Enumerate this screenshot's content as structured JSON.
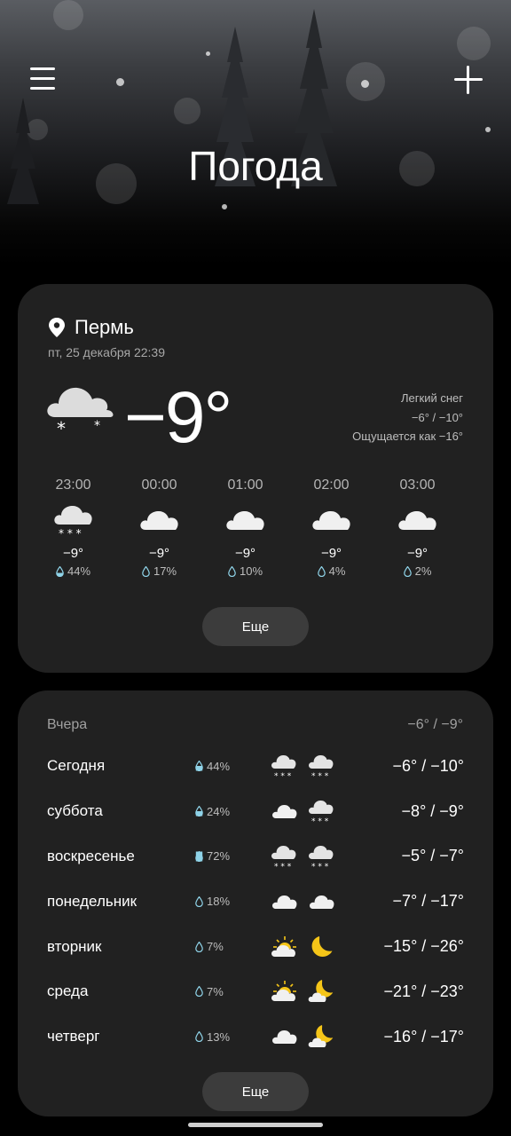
{
  "header": {
    "title": "Погода",
    "menu_icon": "hamburger-icon",
    "add_icon": "plus-icon"
  },
  "current": {
    "location": "Пермь",
    "datetime": "пт, 25 декабря 22:39",
    "temperature": "−9°",
    "condition": "Легкий снег",
    "range": "−6° / −10°",
    "feels_like": "Ощущается как −16°",
    "icon": "light-snow-icon"
  },
  "hourly": [
    {
      "time": "23:00",
      "temp": "−9°",
      "precip": "44%",
      "icon": "snow-cloud-icon"
    },
    {
      "time": "00:00",
      "temp": "−9°",
      "precip": "17%",
      "icon": "cloud-icon"
    },
    {
      "time": "01:00",
      "temp": "−9°",
      "precip": "10%",
      "icon": "cloud-icon"
    },
    {
      "time": "02:00",
      "temp": "−9°",
      "precip": "4%",
      "icon": "cloud-icon"
    },
    {
      "time": "03:00",
      "temp": "−9°",
      "precip": "2%",
      "icon": "cloud-icon"
    }
  ],
  "more_label": "Еще",
  "yesterday": {
    "label": "Вчера",
    "range": "−6° / −9°"
  },
  "daily": [
    {
      "day": "Сегодня",
      "precip": "44%",
      "day_icon": "snow-cloud-icon",
      "night_icon": "snow-cloud-icon",
      "range": "−6° / −10°"
    },
    {
      "day": "суббота",
      "precip": "24%",
      "day_icon": "cloud-icon",
      "night_icon": "snow-cloud-icon",
      "range": "−8° / −9°"
    },
    {
      "day": "воскресенье",
      "precip": "72%",
      "day_icon": "snow-cloud-icon",
      "night_icon": "snow-cloud-icon",
      "range": "−5° / −7°"
    },
    {
      "day": "понедельник",
      "precip": "18%",
      "day_icon": "cloud-icon",
      "night_icon": "cloud-icon",
      "range": "−7° / −17°"
    },
    {
      "day": "вторник",
      "precip": "7%",
      "day_icon": "sun-cloud-icon",
      "night_icon": "moon-icon",
      "range": "−15° / −26°"
    },
    {
      "day": "среда",
      "precip": "7%",
      "day_icon": "sun-cloud-icon",
      "night_icon": "moon-cloud-icon",
      "range": "−21° / −23°"
    },
    {
      "day": "четверг",
      "precip": "13%",
      "day_icon": "cloud-icon",
      "night_icon": "moon-cloud-icon",
      "range": "−16° / −17°"
    }
  ],
  "colors": {
    "card": "#212121",
    "button": "#3c3c3c",
    "drop": "#8fd3e8",
    "moon": "#f5c518"
  }
}
